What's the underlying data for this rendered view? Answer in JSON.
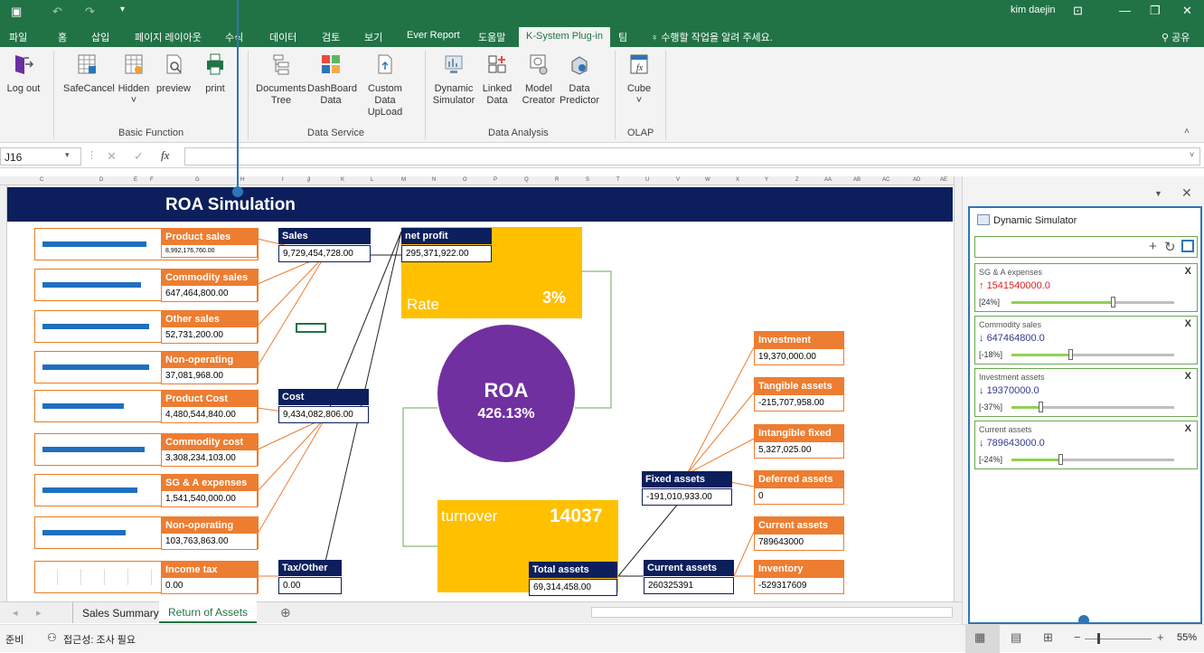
{
  "titlebar": {
    "user": "kim daejin"
  },
  "tabs": [
    "파일",
    "홈",
    "삽입",
    "페이지 레이아웃",
    "수식",
    "데이터",
    "검토",
    "보기",
    "Ever Report",
    "도움말",
    "K-System Plug-in",
    "팀"
  ],
  "tell_me": "수행할 작업을 알려 주세요.",
  "share": "공유",
  "ribbon": {
    "buttons": [
      {
        "l1": "Log out",
        "l2": ""
      },
      {
        "l1": "SafeCancel",
        "l2": ""
      },
      {
        "l1": "Hidden",
        "l2": "˅"
      },
      {
        "l1": "preview",
        "l2": ""
      },
      {
        "l1": "print",
        "l2": ""
      },
      {
        "l1": "Documents",
        "l2": "Tree"
      },
      {
        "l1": "DashBoard",
        "l2": "Data"
      },
      {
        "l1": "Custom Data",
        "l2": "UpLoad"
      },
      {
        "l1": "Dynamic",
        "l2": "Simulator"
      },
      {
        "l1": "Linked",
        "l2": "Data"
      },
      {
        "l1": "Model",
        "l2": "Creator"
      },
      {
        "l1": "Data",
        "l2": "Predictor"
      },
      {
        "l1": "Cube",
        "l2": "˅"
      }
    ],
    "groups": [
      "Basic Function",
      "Data Service",
      "Data Analysis",
      "OLAP"
    ]
  },
  "namebox": "J16",
  "columns": [
    "C",
    "D",
    "E",
    "F",
    "G",
    "H",
    "I",
    "J",
    "K",
    "L",
    "M",
    "N",
    "O",
    "P",
    "Q",
    "R",
    "S",
    "T",
    "U",
    "V",
    "W",
    "X",
    "Y",
    "Z",
    "AA",
    "AB",
    "AC",
    "AD",
    "AE"
  ],
  "sheet": {
    "title": "ROA Simulation",
    "left_items": [
      {
        "label": "Product sales",
        "value": "8,992,176,760.00",
        "fill": 0.9
      },
      {
        "label": "Commodity sales",
        "value": "647,464,800.00",
        "fill": 0.85
      },
      {
        "label": "Other sales",
        "value": "52,731,200.00",
        "fill": 0.92
      },
      {
        "label": "Non-operating",
        "value": "37,081,968.00",
        "fill": 0.92
      },
      {
        "label": "Product Cost",
        "value": "4,480,544,840.00",
        "fill": 0.7
      },
      {
        "label": "Commodity cost",
        "value": "3,308,234,103.00",
        "fill": 0.88
      },
      {
        "label": "SG & A expenses",
        "value": "1,541,540,000.00",
        "fill": 0.82
      },
      {
        "label": "Non-operating",
        "value": "103,763,863.00",
        "fill": 0.72
      },
      {
        "label": "Income tax",
        "value": "0.00",
        "fill": 0
      }
    ],
    "sales": {
      "label": "Sales",
      "value": "9,729,454,728.00"
    },
    "cost": {
      "label": "Cost",
      "value": "9,434,082,806.00"
    },
    "tax": {
      "label": "Tax/Other",
      "value": "0.00"
    },
    "net_profit": {
      "label": "net profit",
      "value": "295,371,922.00"
    },
    "rate": {
      "label": "Rate",
      "value": "3%"
    },
    "roa": {
      "label": "ROA",
      "value": "426.13%"
    },
    "turnover": {
      "label": "turnover",
      "value": "14037"
    },
    "total_assets": {
      "label": "Total assets",
      "value": "69,314,458.00"
    },
    "fixed_assets": {
      "label": "Fixed assets",
      "value": "-191,010,933.00"
    },
    "current_assets_mid": {
      "label": "Current assets",
      "value": "260325391"
    },
    "right_items": [
      {
        "label": "Investment",
        "value": "19,370,000.00"
      },
      {
        "label": "Tangible assets",
        "value": "-215,707,958.00"
      },
      {
        "label": "Intangible fixed",
        "value": "5,327,025.00"
      },
      {
        "label": "Deferred assets",
        "value": "0"
      },
      {
        "label": "Current assets",
        "value": "789643000"
      },
      {
        "label": "Inventory",
        "value": "-529317609"
      }
    ]
  },
  "panel": {
    "title": "Dynamic Simulator",
    "cards": [
      {
        "name": "SG & A expenses",
        "arrow": "↑",
        "value": "1541540000.0",
        "pct": "[24%]",
        "color": "#e02020",
        "level": 0.62
      },
      {
        "name": "Commodity sales",
        "arrow": "↓",
        "value": "647464800.0",
        "pct": "[-18%]",
        "color": "#2f3b8f",
        "level": 0.36
      },
      {
        "name": "Investment assets",
        "arrow": "↓",
        "value": "19370000.0",
        "pct": "[-37%]",
        "color": "#2f3b8f",
        "level": 0.18
      },
      {
        "name": "Current assets",
        "arrow": "↓",
        "value": "789643000.0",
        "pct": "[-24%]",
        "color": "#2f3b8f",
        "level": 0.3
      }
    ]
  },
  "sheet_tabs": [
    "Sales Summary",
    "Return of Assets"
  ],
  "status": {
    "ready": "준비",
    "accessibility": "접근성: 조사 필요",
    "zoom": "55%"
  }
}
